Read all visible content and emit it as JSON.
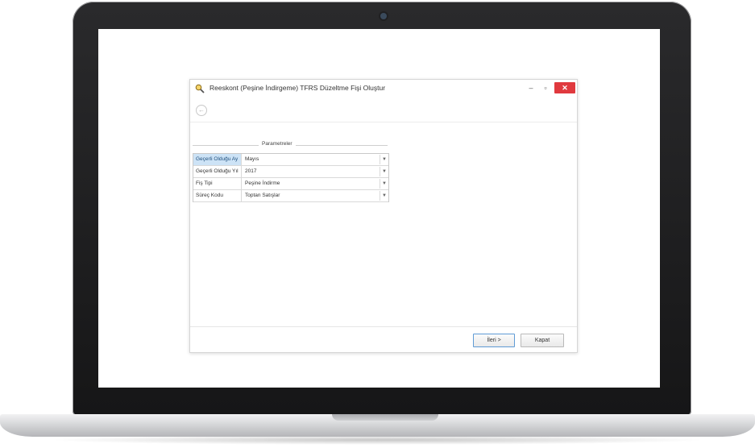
{
  "window": {
    "title": "Reeskont (Peşine İndirgeme) TFRS Düzeltme Fişi Oluştur",
    "minimize_glyph": "–",
    "maximize_glyph": "▫",
    "close_glyph": "✕"
  },
  "toolbar": {
    "back_glyph": "←"
  },
  "parameters": {
    "legend": "Parametreler",
    "rows": [
      {
        "label": "Geçerli Olduğu Ay",
        "value": "Mayıs",
        "selected": true
      },
      {
        "label": "Geçerli Olduğu Yıl",
        "value": "2017",
        "selected": false
      },
      {
        "label": "Fiş Tipi",
        "value": "Peşine İndirme",
        "selected": false
      },
      {
        "label": "Süreç Kodu",
        "value": "Toptan Satışlar",
        "selected": false
      }
    ]
  },
  "footer": {
    "next_label": "İleri >",
    "close_label": "Kapat"
  },
  "icons": {
    "app": "magnifier-icon",
    "back": "back-arrow-icon",
    "dropdown": "chevron-down-icon"
  },
  "colors": {
    "close_button": "#e0393e",
    "selected_row": "#cde3f6",
    "next_button_border": "#5f9bd5"
  }
}
